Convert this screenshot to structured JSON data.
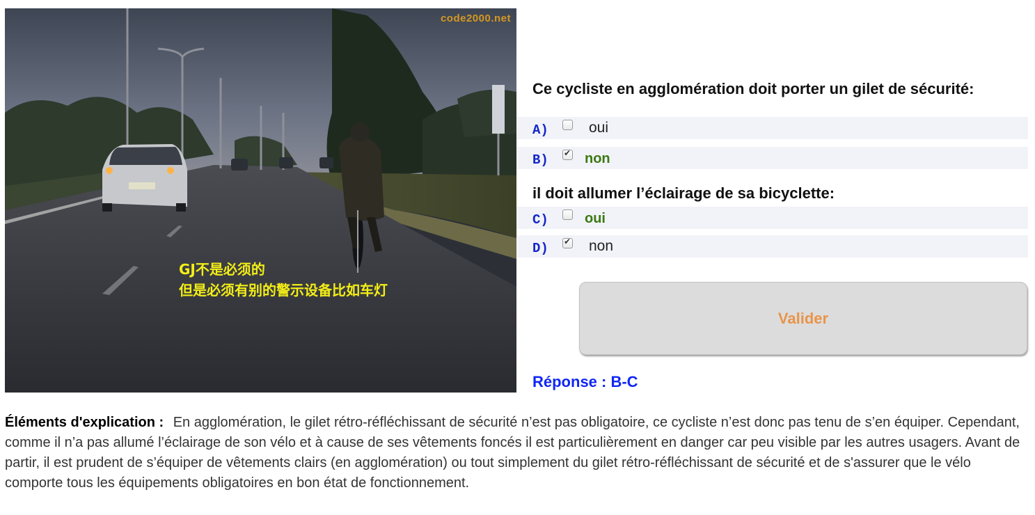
{
  "photo": {
    "watermark": "code2000.net",
    "overlay_line1": "GJ不是必须的",
    "overlay_line2": "但是必须有别的警示设备比如车灯"
  },
  "question1": {
    "title": "Ce cycliste en agglomération doit porter un gilet de sécurité:",
    "options": [
      {
        "letter": "A)",
        "text": "oui",
        "checked": false,
        "correct": false
      },
      {
        "letter": "B)",
        "text": "non",
        "checked": true,
        "correct": true
      }
    ]
  },
  "question2": {
    "title": "il doit allumer l’éclairage de sa bicyclette:",
    "options": [
      {
        "letter": "C)",
        "text": "oui",
        "checked": false,
        "correct": true
      },
      {
        "letter": "D)",
        "text": "non",
        "checked": true,
        "correct": false
      }
    ]
  },
  "valider_label": "Valider",
  "reponse": "Réponse : B-C",
  "explication": {
    "label": "Éléments d'explication :",
    "text": "En agglomération, le gilet rétro-réfléchissant de sécurité n’est pas obligatoire, ce cycliste n’est donc pas tenu de s’en équiper. Cependant, comme il n’a pas allumé l’éclairage de son vélo et à cause de ses vêtements foncés il est particulièrement en danger car peu visible par les autres usagers. Avant de partir, il est prudent de s’équiper de vêtements clairs (en agglomération) ou tout simplement du gilet rétro-réfléchissant de sécurité et de s'assurer que le vélo comporte tous les équipements obligatoires en bon état de fonctionnement."
  },
  "colors": {
    "correct_text": "#3a7a12",
    "option_letter": "#1427c9",
    "reponse": "#1027f5",
    "valider_text": "#e8954a",
    "overlay_text": "#f3ee16"
  }
}
